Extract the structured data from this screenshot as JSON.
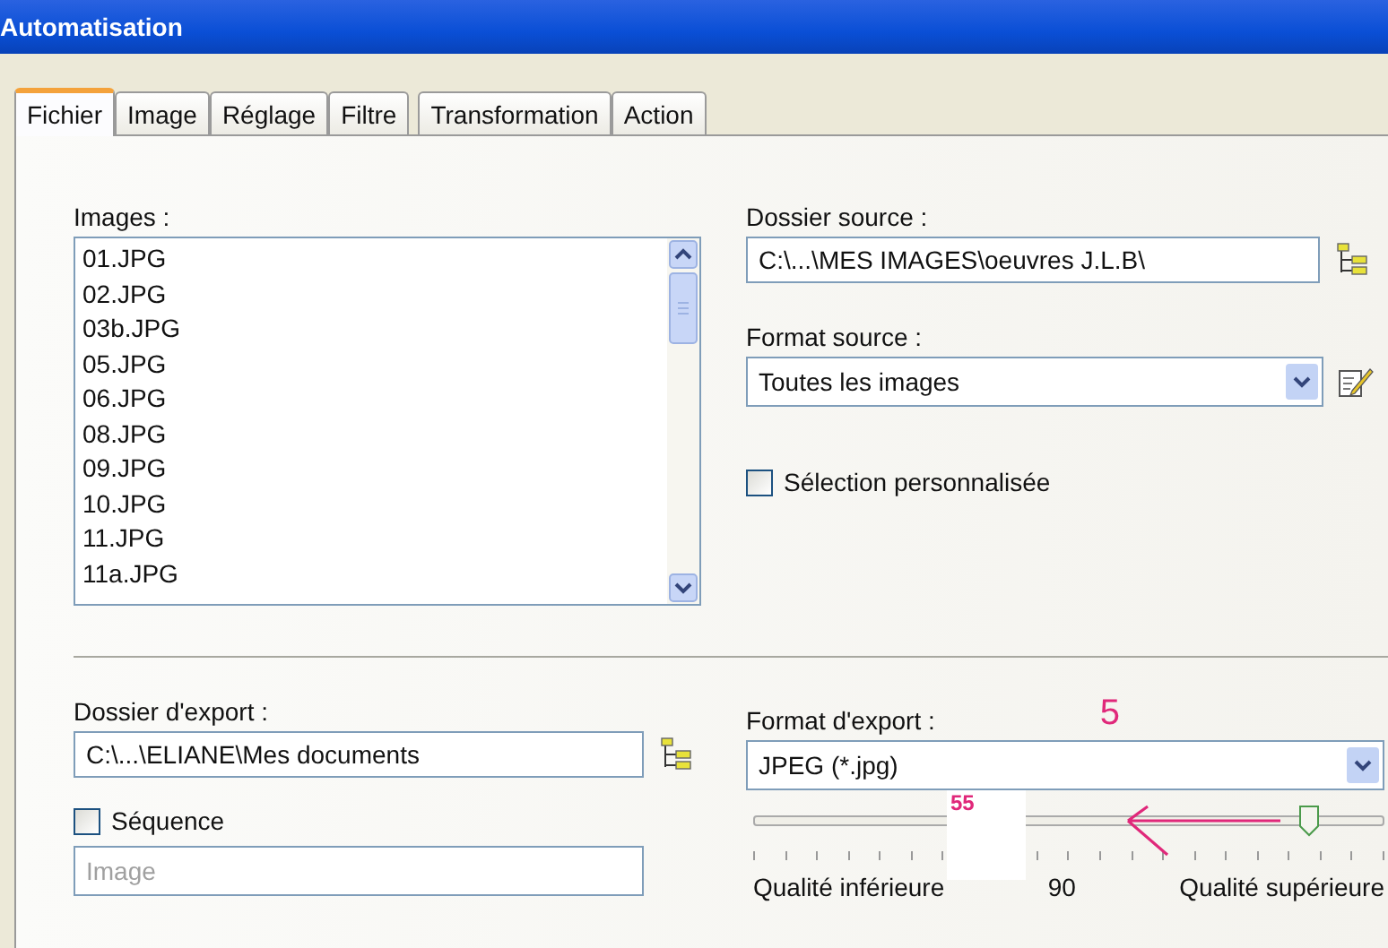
{
  "window": {
    "title": "Automatisation"
  },
  "tabs": [
    {
      "label": "Fichier",
      "selected": true
    },
    {
      "label": "Image",
      "selected": false
    },
    {
      "label": "Réglage",
      "selected": false
    },
    {
      "label": "Filtre",
      "selected": false
    },
    {
      "label": "Transformation",
      "selected": false
    },
    {
      "label": "Action",
      "selected": false
    }
  ],
  "images": {
    "label": "Images :",
    "items": [
      "01.JPG",
      "02.JPG",
      "03b.JPG",
      "05.JPG",
      "06.JPG",
      "08.JPG",
      "09.JPG",
      "10.JPG",
      "11.JPG",
      "11a.JPG"
    ]
  },
  "source_folder": {
    "label": "Dossier source :",
    "value": "C:\\...\\MES IMAGES\\oeuvres J.L.B\\"
  },
  "source_format": {
    "label": "Format source :",
    "value": "Toutes les images"
  },
  "custom_selection": {
    "label": "Sélection personnalisée",
    "checked": false
  },
  "export_folder": {
    "label": "Dossier d'export :",
    "value": "C:\\...\\ELIANE\\Mes documents"
  },
  "sequence": {
    "label": "Séquence",
    "checked": false,
    "placeholder": "Image"
  },
  "export_format": {
    "label": "Format d'export :",
    "value": "JPEG (*.jpg)"
  },
  "quality": {
    "level": 0.88,
    "low_label": "Qualité inférieure",
    "value": "90",
    "high_label": "Qualité supérieure"
  },
  "annotations": [
    {
      "kind": "number",
      "text": "5"
    },
    {
      "kind": "patch",
      "text": "55"
    },
    {
      "kind": "arrow"
    }
  ]
}
